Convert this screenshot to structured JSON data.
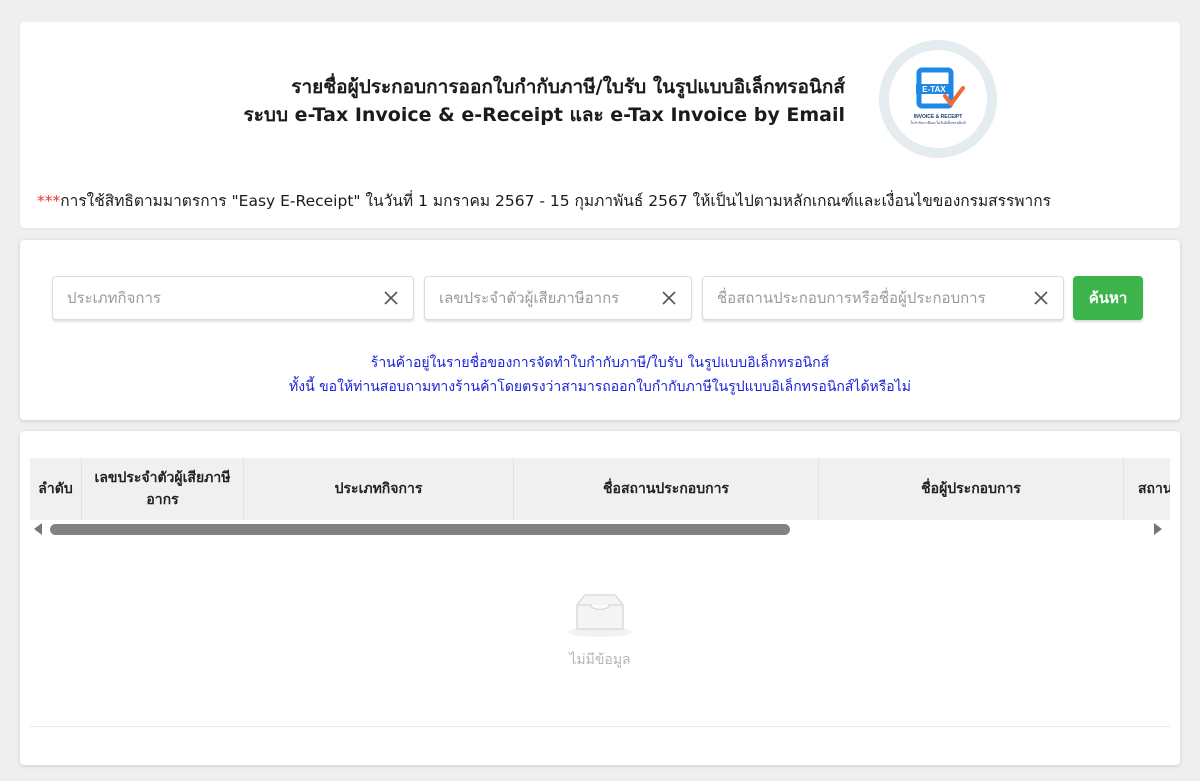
{
  "header": {
    "title_line1": "รายชื่อผู้ประกอบการออกใบกำกับภาษี/ใบรับ ในรูปแบบอิเล็กทรอนิกส์",
    "title_line2": "ระบบ e-Tax Invoice & e-Receipt และ e-Tax Invoice by Email",
    "logo": {
      "text": "E-TAX",
      "subtitle": "INVOICE & RECEIPT",
      "caption": "ใบกำกับภาษีและใบรับอิเล็กทรอนิกส์",
      "colors": {
        "primary": "#1e88e5",
        "check": "#ef6c3a"
      }
    },
    "notice_stars": "***",
    "notice_text": "การใช้สิทธิตามมาตรการ \"Easy E-Receipt\" ในวันที่ 1 มกราคม 2567 - 15 กุมภาพันธ์ 2567 ให้เป็นไปตามหลักเกณฑ์และเงื่อนไขของกรมสรรพากร"
  },
  "search": {
    "business_type": {
      "value": "",
      "placeholder": "ประเภทกิจการ",
      "clear_icon": "close-icon"
    },
    "tax_id": {
      "value": "",
      "placeholder": "เลขประจำตัวผู้เสียภาษีอากร",
      "clear_icon": "close-icon"
    },
    "name": {
      "value": "",
      "placeholder": "ชื่อสถานประกอบการหรือชื่อผู้ประกอบการ",
      "clear_icon": "close-icon"
    },
    "button_label": "ค้นหา",
    "button_color": "#3cb44b",
    "info_line1": "ร้านค้าอยู่ในรายชื่อของการจัดทำใบกำกับภาษี/ใบรับ ในรูปแบบอิเล็กทรอนิกส์",
    "info_line2": "ทั้งนี้ ขอให้ท่านสอบถามทางร้านค้าโดยตรงว่าสามารถออกใบกำกับภาษีในรูปแบบอิเล็กทรอนิกส์ได้หรือไม่",
    "info_color": "#1a23d6"
  },
  "table": {
    "columns": [
      "ลำดับ",
      "เลขประจำตัวผู้เสียภาษีอากร",
      "ประเภทกิจการ",
      "ชื่อสถานประกอบการ",
      "ชื่อผู้ประกอบการ",
      "สถาน"
    ],
    "rows": [],
    "empty_text": "ไม่มีข้อมูล",
    "empty_icon": "inbox-icon"
  }
}
